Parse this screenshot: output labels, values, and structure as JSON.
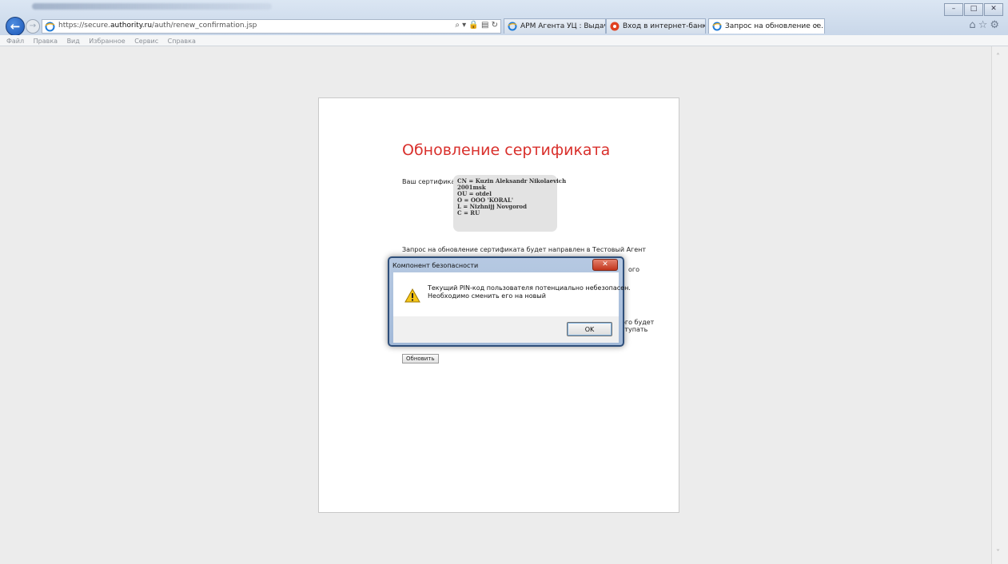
{
  "browser": {
    "url_prefix": "https://secure.",
    "url_domain": "authority.ru",
    "url_path": "/auth/renew_confirmation.jsp",
    "address_icons": "⌕ ▾ 🔒 ▤ ↻",
    "tabs": [
      {
        "label": "АРМ Агента УЦ : Выдача серт...",
        "active": false,
        "icon": "ie-icon"
      },
      {
        "label": "Вход в интернет-банк",
        "active": false,
        "icon": "bank-icon"
      },
      {
        "label": "Запрос на обновление се...",
        "active": true,
        "icon": "ie-icon",
        "close": "×"
      }
    ],
    "window_controls": {
      "minimize": "–",
      "maximize": "□",
      "close": "✕"
    },
    "toolbar_icons": {
      "home": "⌂",
      "favorites": "☆",
      "tools": "⚙"
    },
    "back_glyph": "←",
    "forward_glyph": "→"
  },
  "menu": [
    "Файл",
    "Правка",
    "Вид",
    "Избранное",
    "Сервис",
    "Справка"
  ],
  "page": {
    "title": "Обновление сертификата",
    "cert_label": "Ваш сертификат",
    "cert_lines": [
      "CN = Kuzin Aleksandr Nikolaevich",
      "2001msk",
      "OU = otdel",
      "O = OOO 'KORAL'",
      "L = Nizhnijj Novgorod",
      "C = RU"
    ],
    "request_text": "Запрос на обновление сертификата будет направлен в Тестовый Агент",
    "tail_1": "ого",
    "tail_2a": "ого будет",
    "tail_2b": "ступать",
    "renew_button": "Обновить"
  },
  "dialog": {
    "title": "Компонент безопасности",
    "close_glyph": "✕",
    "message_line1": "Текущий PIN-код пользователя потенциально небезопасен.",
    "message_line2": "Необходимо сменить его на новый",
    "ok_label": "OK"
  },
  "scrollbar": {
    "up": "˄",
    "down": "˅"
  },
  "colors": {
    "title_red": "#d9302c",
    "accent_blue": "#1a55b5"
  }
}
